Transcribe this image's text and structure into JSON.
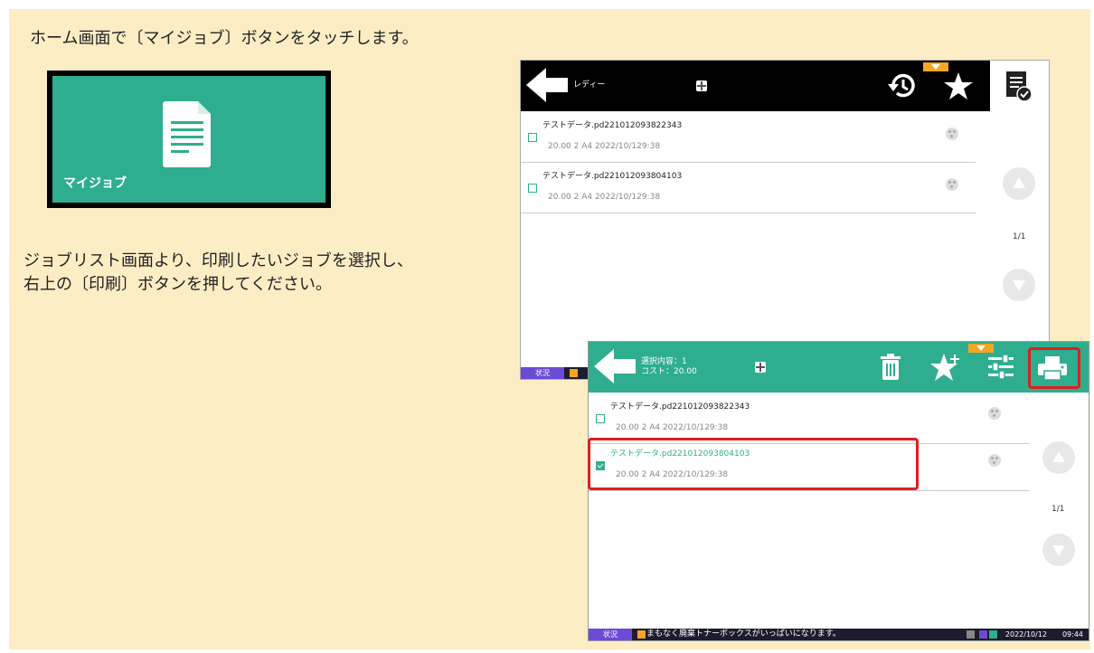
{
  "instructions": {
    "step1": "ホーム画面で〔マイジョブ〕ボタンをタッチします。",
    "step2_line1": "ジョブリスト画面より、印刷したいジョブを選択し、",
    "step2_line2": "右上の〔印刷〕ボタンを押してください。"
  },
  "home_tile": {
    "label": "マイジョブ",
    "icon": "document-icon",
    "color": "#2eae8e"
  },
  "screen1": {
    "status": "レディー",
    "icons": [
      "back-arrow-icon",
      "grid-icon",
      "history-icon",
      "star-icon",
      "myjob-check-icon"
    ],
    "jobs": [
      {
        "name": "テストデータ.pd221012093822343",
        "meta": "20.00  2  A4   2022/10/129:38"
      },
      {
        "name": "テストデータ.pd221012093804103",
        "meta": "20.00  2  A4   2022/10/129:38"
      }
    ],
    "page": "1/1",
    "statusbar_state": "状況"
  },
  "screen2": {
    "selection_line1": "選択内容：1",
    "selection_line2": "コスト：20.00",
    "icons": [
      "back-arrow-icon",
      "grid-icon",
      "trash-icon",
      "star-add-icon",
      "settings-sliders-icon",
      "print-icon"
    ],
    "jobs": [
      {
        "name": "テストデータ.pd221012093822343",
        "meta": "20.00  2  A4   2022/10/129:38",
        "selected": false
      },
      {
        "name": "テストデータ.pd221012093804103",
        "meta": "20.00  2  A4   2022/10/129:38",
        "selected": true
      }
    ],
    "page": "1/1",
    "statusbar": {
      "state": "状況",
      "message": "まもなく廃棄トナーボックスがいっぱいになります。",
      "date": "2022/10/12",
      "time": "09:44"
    }
  },
  "colors": {
    "accent": "#2eae8e",
    "highlight": "#e01e1e",
    "background": "#fdedc5",
    "warning": "#f5a623"
  }
}
